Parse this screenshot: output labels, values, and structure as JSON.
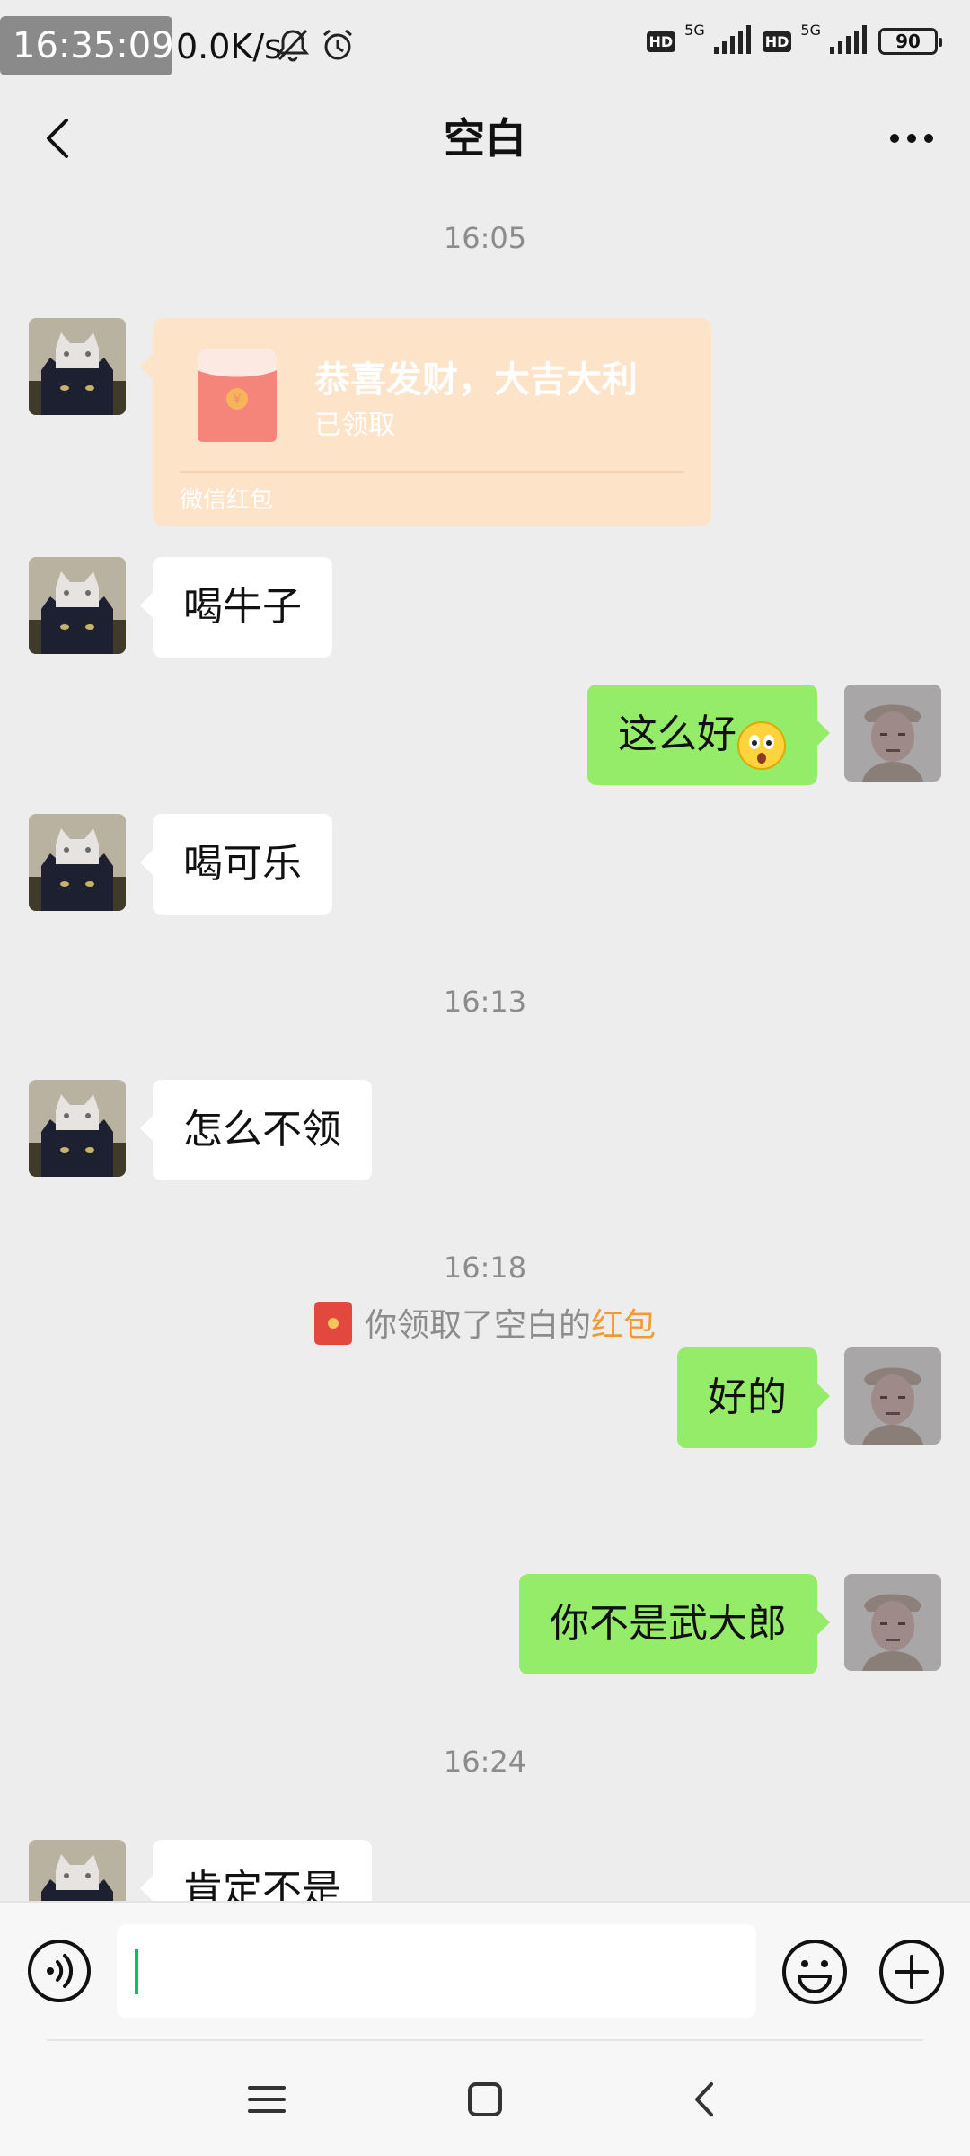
{
  "status_bar": {
    "time": "16:35:09",
    "net_speed": "0.0K/s",
    "battery": "90",
    "hd_label": "HD",
    "net_label": "5G",
    "icons": [
      "bell-off-icon",
      "alarm-icon",
      "signal-icon",
      "battery-icon"
    ]
  },
  "header": {
    "title": "空白",
    "back_icon": "chevron-left-icon",
    "more_icon": "more-dots-icon"
  },
  "messages": {
    "ts1": "16:05",
    "red_packet": {
      "title": "恭喜发财，大吉大利",
      "status": "已领取",
      "footer": "微信红包"
    },
    "m1": "喝牛子",
    "m2": "这么好",
    "m2_emoji": "surprised-emoji",
    "m3": "喝可乐",
    "ts2": "16:13",
    "m4": "怎么不领",
    "ts3": "16:18",
    "m5": "好的",
    "system_notice": {
      "prefix": "你领取了空白的",
      "link": "红包"
    },
    "m6": "你不是武大郎",
    "ts4": "16:24",
    "m7": "肯定不是"
  },
  "input_bar": {
    "text_value": "",
    "icons": [
      "voice-icon",
      "emoji-icon",
      "plus-icon"
    ]
  },
  "nav_bar": {
    "icons": [
      "menu-icon",
      "home-icon",
      "back-icon"
    ]
  },
  "colors": {
    "background": "#ededed",
    "outgoing_bubble": "#95ec69",
    "incoming_bubble": "#ffffff",
    "red_packet_received": "#fde3c8",
    "link_orange": "#f09b30",
    "caret_green": "#07c160"
  }
}
